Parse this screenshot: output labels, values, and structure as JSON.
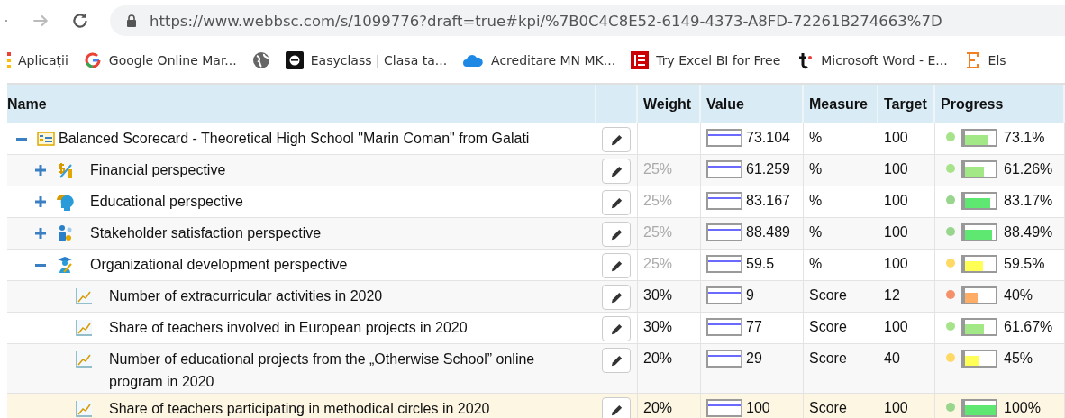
{
  "browser": {
    "url": "https://www.webbsc.com/s/1099776?draft=true#kpi/%7B0C4C8E52-6149-4373-A8FD-72261B274663%7D",
    "bookmarks": [
      {
        "kind": "apps",
        "label": "Aplicații"
      },
      {
        "kind": "g",
        "label": "Google Online Mar..."
      },
      {
        "kind": "globe"
      },
      {
        "kind": "e",
        "label": "Easyclass | Clasa ta..."
      },
      {
        "kind": "cloud",
        "label": "Acreditare MN MK..."
      },
      {
        "kind": "excel",
        "label": "Try Excel BI for Free"
      },
      {
        "kind": "t",
        "label": "Microsoft Word - E..."
      },
      {
        "kind": "E",
        "label": "Els"
      }
    ]
  },
  "table": {
    "columns": [
      "Name",
      "",
      "Weight",
      "Value",
      "Measure",
      "Target",
      "Progress"
    ],
    "rows": [
      {
        "kind": "scorecard",
        "name": "Balanced Scorecard - Theoretical High School \"Marin Coman\" from Galati",
        "expanded": true,
        "selected": false,
        "value": "73.104",
        "measure": "%",
        "target": "100",
        "progress": "73.1%",
        "dot": {
          "color": "#a6e38a"
        },
        "bar": {
          "level": 0.73,
          "color": "#a3e887"
        },
        "children": [
          {
            "kind": "financial",
            "name": "Financial perspective",
            "expanded": false,
            "selected": false,
            "weight": "25%",
            "weight_muted": true,
            "value": "61.259",
            "measure": "%",
            "target": "100",
            "progress": "61.26%",
            "dot": {
              "color": "#a6e38a"
            },
            "bar": {
              "level": 0.61,
              "color": "#a3e887"
            }
          },
          {
            "kind": "educational",
            "name": "Educational perspective",
            "expanded": false,
            "selected": false,
            "weight": "25%",
            "weight_muted": true,
            "value": "83.167",
            "measure": "%",
            "target": "100",
            "progress": "83.17%",
            "dot": {
              "color": "#98d68e"
            },
            "bar": {
              "level": 0.83,
              "color": "#5ee872"
            }
          },
          {
            "kind": "stakeholder",
            "name": "Stakeholder satisfaction perspective",
            "expanded": false,
            "selected": false,
            "weight": "25%",
            "weight_muted": true,
            "value": "88.489",
            "measure": "%",
            "target": "100",
            "progress": "88.49%",
            "dot": {
              "color": "#98d68e"
            },
            "bar": {
              "level": 0.88,
              "color": "#5ee872"
            }
          },
          {
            "kind": "organizational",
            "name": "Organizational development perspective",
            "expanded": true,
            "selected": false,
            "weight": "25%",
            "weight_muted": true,
            "value": "59.5",
            "measure": "%",
            "target": "100",
            "progress": "59.5%",
            "dot": {
              "color": "#ffd966"
            },
            "bar": {
              "level": 0.6,
              "color": "#ffff55"
            },
            "children": [
              {
                "kind": "kpi",
                "name": "Number of extracurricular activities in 2020",
                "selected": false,
                "weight": "30%",
                "weight_muted": false,
                "value": "9",
                "measure": "Score",
                "target": "12",
                "progress": "40%",
                "dot": {
                  "color": "#f4916b"
                },
                "bar": {
                  "level": 0.4,
                  "color": "#ffad66"
                }
              },
              {
                "kind": "kpi",
                "name": "Share of teachers involved in European projects in 2020",
                "selected": false,
                "weight": "30%",
                "weight_muted": false,
                "value": "77",
                "measure": "Score",
                "target": "100",
                "progress": "61.67%",
                "dot": {
                  "color": "#a6e38a"
                },
                "bar": {
                  "level": 0.62,
                  "color": "#a3e887"
                }
              },
              {
                "kind": "kpi",
                "name": "Number of educational projects from the „Otherwise School” online program in 2020",
                "selected": false,
                "weight": "20%",
                "weight_muted": false,
                "value": "29",
                "measure": "Score",
                "target": "40",
                "progress": "45%",
                "dot": {
                  "color": "#ffd966"
                },
                "bar": {
                  "level": 0.45,
                  "color": "#ffff55"
                }
              },
              {
                "kind": "kpi",
                "name": "Share of teachers participating in methodical circles in 2020",
                "selected": true,
                "weight": "20%",
                "weight_muted": false,
                "value": "100",
                "measure": "Score",
                "target": "100",
                "progress": "100%",
                "dot": {
                  "color": "#98d68e"
                },
                "bar": {
                  "level": 1,
                  "color": "#5ee872"
                }
              }
            ]
          }
        ]
      }
    ]
  }
}
